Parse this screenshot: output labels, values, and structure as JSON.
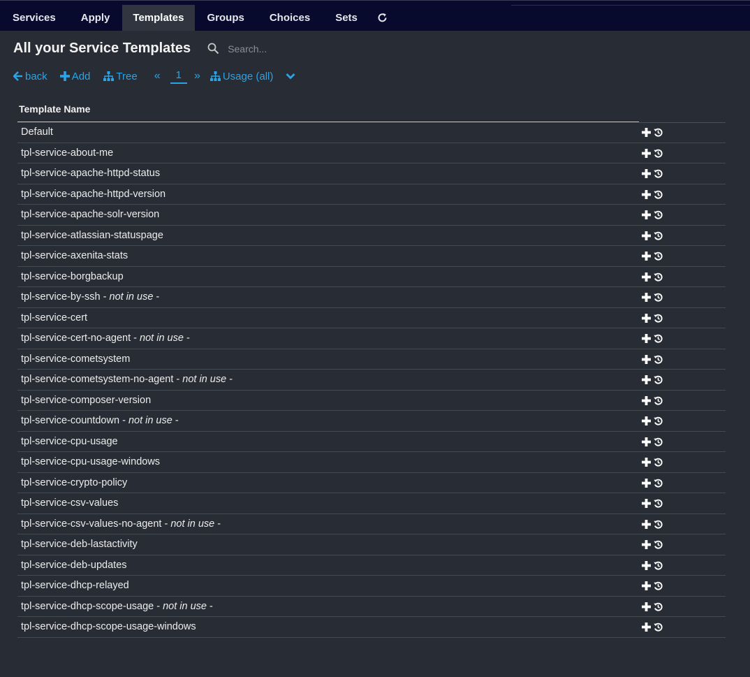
{
  "nav": {
    "tabs": [
      {
        "label": "Services"
      },
      {
        "label": "Apply"
      },
      {
        "label": "Templates"
      },
      {
        "label": "Groups"
      },
      {
        "label": "Choices"
      },
      {
        "label": "Sets"
      }
    ],
    "active_tab": "Templates",
    "refresh_icon": "refresh-icon"
  },
  "header": {
    "title": "All your Service Templates",
    "search_placeholder": "Search..."
  },
  "actions": {
    "back": "back",
    "add": "Add",
    "tree": "Tree",
    "page": "1",
    "usage": "Usage (all)"
  },
  "table": {
    "column_header": "Template Name",
    "rows": [
      {
        "name": "Default",
        "note": ""
      },
      {
        "name": "tpl-service-about-me",
        "note": ""
      },
      {
        "name": "tpl-service-apache-httpd-status",
        "note": ""
      },
      {
        "name": "tpl-service-apache-httpd-version",
        "note": ""
      },
      {
        "name": "tpl-service-apache-solr-version",
        "note": ""
      },
      {
        "name": "tpl-service-atlassian-statuspage",
        "note": ""
      },
      {
        "name": "tpl-service-axenita-stats",
        "note": ""
      },
      {
        "name": "tpl-service-borgbackup",
        "note": ""
      },
      {
        "name": "tpl-service-by-ssh",
        "note": "not in use"
      },
      {
        "name": "tpl-service-cert",
        "note": ""
      },
      {
        "name": "tpl-service-cert-no-agent",
        "note": "not in use"
      },
      {
        "name": "tpl-service-cometsystem",
        "note": ""
      },
      {
        "name": "tpl-service-cometsystem-no-agent",
        "note": "not in use"
      },
      {
        "name": "tpl-service-composer-version",
        "note": ""
      },
      {
        "name": "tpl-service-countdown",
        "note": "not in use"
      },
      {
        "name": "tpl-service-cpu-usage",
        "note": ""
      },
      {
        "name": "tpl-service-cpu-usage-windows",
        "note": ""
      },
      {
        "name": "tpl-service-crypto-policy",
        "note": ""
      },
      {
        "name": "tpl-service-csv-values",
        "note": ""
      },
      {
        "name": "tpl-service-csv-values-no-agent",
        "note": "not in use"
      },
      {
        "name": "tpl-service-deb-lastactivity",
        "note": ""
      },
      {
        "name": "tpl-service-deb-updates",
        "note": ""
      },
      {
        "name": "tpl-service-dhcp-relayed",
        "note": ""
      },
      {
        "name": "tpl-service-dhcp-scope-usage",
        "note": "not in use"
      },
      {
        "name": "tpl-service-dhcp-scope-usage-windows",
        "note": ""
      }
    ]
  },
  "colors": {
    "nav_bg": "#070a2c",
    "page_bg": "#282c34",
    "link": "#2aa4e6",
    "active_tab_bg": "#30353f"
  }
}
